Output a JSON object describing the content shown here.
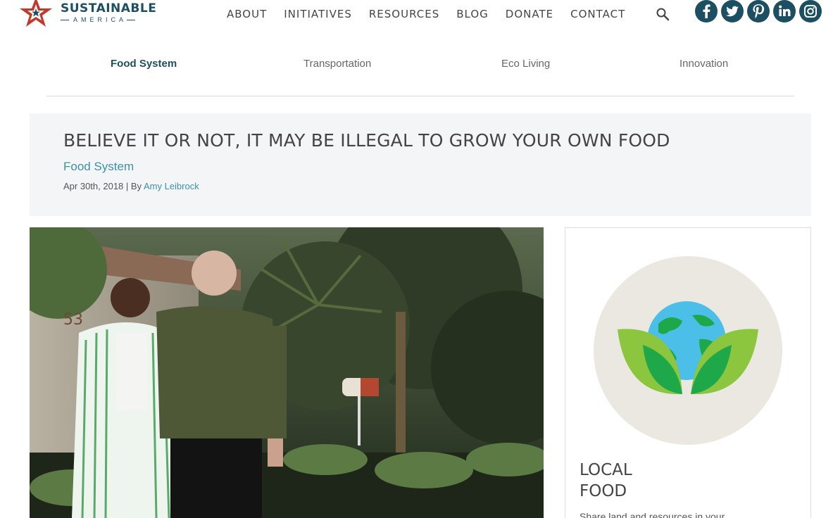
{
  "header": {
    "logo_main": "SUSTAINABLE",
    "logo_sub": "AMERICA",
    "nav": [
      "ABOUT",
      "INITIATIVES",
      "RESOURCES",
      "BLOG",
      "DONATE",
      "CONTACT"
    ],
    "social": {
      "facebook": "f",
      "twitter": "t",
      "pinterest": "p",
      "linkedin": "in",
      "instagram": "ig"
    }
  },
  "tabs": [
    "Food System",
    "Transportation",
    "Eco Living",
    "Innovation"
  ],
  "article": {
    "title": "BELIEVE IT OR NOT, IT MAY BE ILLEGAL TO GROW YOUR OWN FOOD",
    "category": "Food System",
    "date": "Apr 30th, 2018",
    "by": " | By ",
    "author": "Amy Leibrock",
    "photo_house_number": "53"
  },
  "sidebar": {
    "title_line1": "LOCAL",
    "title_line2": "FOOD",
    "text": "Share land and resources in your"
  },
  "colors": {
    "brand": "#1d4f63",
    "link": "#3a93a8",
    "logo_star": "#c0392b"
  }
}
